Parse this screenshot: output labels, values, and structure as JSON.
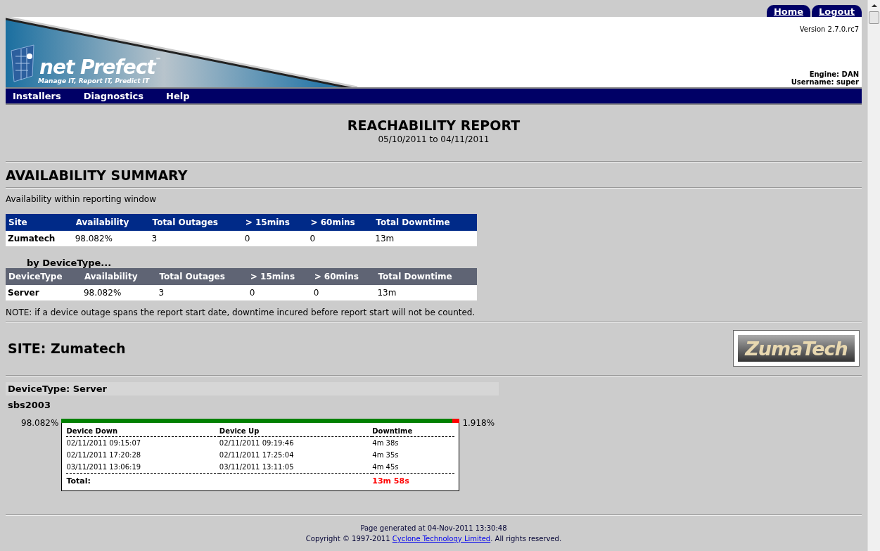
{
  "top_tabs": [
    {
      "label": "Home"
    },
    {
      "label": "Logout"
    }
  ],
  "banner": {
    "logo_name": "net Prefect",
    "logo_tm": "™",
    "logo_tagline": "Manage IT, Report IT, Predict IT",
    "version": "Version 2.7.0.rc7",
    "engine": "Engine: DAN",
    "username": "Username: super"
  },
  "menu": [
    {
      "label": "Installers"
    },
    {
      "label": "Diagnostics"
    },
    {
      "label": "Help"
    }
  ],
  "report": {
    "title": "REACHABILITY REPORT",
    "range": "05/10/2011 to 04/11/2011"
  },
  "summary": {
    "heading": "AVAILABILITY SUMMARY",
    "subtitle": "Availability within reporting window",
    "site_table": {
      "columns": [
        "Site",
        "Availability",
        "Total Outages",
        "> 15mins",
        "> 60mins",
        "Total Downtime"
      ],
      "rows": [
        [
          "Zumatech",
          "98.082%",
          "3",
          "0",
          "0",
          "13m"
        ]
      ]
    },
    "by_label": "by DeviceType...",
    "type_table": {
      "columns": [
        "DeviceType",
        "Availability",
        "Total Outages",
        "> 15mins",
        "> 60mins",
        "Total Downtime"
      ],
      "rows": [
        [
          "Server",
          "98.082%",
          "3",
          "0",
          "0",
          "13m"
        ]
      ]
    },
    "note": "NOTE: if a device outage spans the report start date, downtime incured before report start will not be counted."
  },
  "site": {
    "heading": "SITE: Zumatech",
    "logo_text": "ZumaTech",
    "device_type": "DeviceType: Server",
    "devices": [
      {
        "name": "sbs2003",
        "up_reading": "98.082%",
        "level": 0.98082,
        "down_reading": "1.918%",
        "columns": [
          "Device Down",
          "Device Up",
          "Downtime"
        ],
        "rows": [
          [
            "02/11/2011 09:15:07",
            "02/11/2011 09:19:46",
            "4m 38s"
          ],
          [
            "02/11/2011 17:20:28",
            "02/11/2011 17:25:04",
            "4m 35s"
          ],
          [
            "03/11/2011 13:06:19",
            "03/11/2011 13:11:05",
            "4m 45s"
          ]
        ],
        "total_label": "Total:",
        "total": "13m 58s"
      }
    ]
  },
  "footer": {
    "generated": "Page generated at 04-Nov-2011 13:30:48",
    "copyright_before": "Copyright © 1997-2011 ",
    "copyright_link": "Cyclone Technology Limited",
    "copyright_after": ". All rights reserved."
  }
}
